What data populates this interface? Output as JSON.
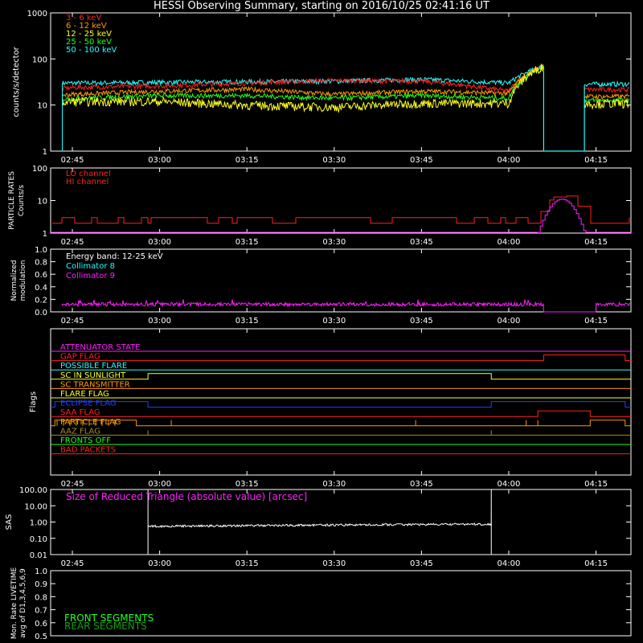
{
  "title": "HESSI Observing Summary, starting on 2016/10/25 02:41:16 UT",
  "time_ticks": [
    "02:45",
    "03:00",
    "03:15",
    "03:30",
    "03:45",
    "04:00",
    "04:15"
  ],
  "colors": {
    "red": "#ff2020",
    "orange": "#ff9a00",
    "yellow": "#ffff20",
    "green": "#20ff20",
    "cyan": "#20ffff",
    "magenta": "#ff20ff",
    "blue": "#2040ff",
    "olive": "#a08a30",
    "white": "#ffffff"
  },
  "chart_data": [
    {
      "type": "line",
      "ylabel": "counts/s/detector",
      "yscale": "log",
      "ylim": [
        1,
        1000
      ],
      "yticks": [
        "1",
        "10",
        "100",
        "1000"
      ],
      "series": [
        {
          "name": "3 - 6 keV",
          "color": "#ff2020"
        },
        {
          "name": "6 - 12 keV",
          "color": "#ff9a00"
        },
        {
          "name": "12 - 25 keV",
          "color": "#ffff20"
        },
        {
          "name": "25 - 50 keV",
          "color": "#20ff20"
        },
        {
          "name": "50 - 100 keV",
          "color": "#20ffff"
        }
      ],
      "x": [
        "02:42",
        "02:45",
        "03:00",
        "03:15",
        "03:30",
        "03:45",
        "04:00",
        "04:06"
      ],
      "values": [
        [
          22,
          24,
          26,
          30,
          34,
          33,
          20,
          70
        ],
        [
          16,
          17,
          20,
          22,
          17,
          20,
          18,
          70
        ],
        [
          11,
          12,
          12,
          10,
          9,
          11,
          11,
          70
        ],
        [
          13,
          14,
          16,
          16,
          14,
          16,
          14,
          70
        ],
        [
          30,
          30,
          31,
          32,
          33,
          36,
          30,
          70
        ]
      ],
      "gap": [
        "04:06",
        "04:13"
      ]
    },
    {
      "type": "line",
      "ylabel": "PARTICLE RATES Counts/s",
      "yscale": "log",
      "ylim": [
        1,
        100
      ],
      "yticks": [
        "1",
        "10",
        "100"
      ],
      "series": [
        {
          "name": "LO channel",
          "color": "#ff2020"
        },
        {
          "name": "HI channel",
          "color": "#ff20ff"
        }
      ],
      "lo_baseline": [
        2,
        3
      ],
      "peak_time": "04:09",
      "peak_values": [
        15,
        11
      ]
    },
    {
      "type": "line",
      "ylabel": "Normalized modulation",
      "ylim": [
        0,
        1
      ],
      "yticks": [
        "0.0",
        "0.2",
        "0.4",
        "0.6",
        "0.8",
        "1.0"
      ],
      "annotation": "Energy band: 12-25 keV",
      "series": [
        {
          "name": "Collimator 8",
          "color": "#20ffff"
        },
        {
          "name": "Collimator 9",
          "color": "#ff20ff",
          "mean": 0.12
        }
      ],
      "gap": [
        "04:06",
        "04:15"
      ]
    },
    {
      "type": "table",
      "ylabel": "Flags",
      "flags": [
        {
          "name": "ATTENUATOR STATE",
          "color": "#ff20ff",
          "on": []
        },
        {
          "name": "GAP FLAG",
          "color": "#ff2020",
          "on": [
            [
              "04:06",
              "04:20"
            ]
          ]
        },
        {
          "name": "POSSIBLE FLARE",
          "color": "#20ffff",
          "on": []
        },
        {
          "name": "SC IN SUNLIGHT",
          "color": "#ffff20",
          "on": [
            [
              "02:58",
              "03:57"
            ]
          ]
        },
        {
          "name": "SC TRANSMITTER",
          "color": "#ff9a00",
          "on": []
        },
        {
          "name": "FLARE FLAG",
          "color": "#ffff20",
          "on": []
        },
        {
          "name": "ECLIPSE FLAG",
          "color": "#2040ff",
          "on": [
            [
              "02:42",
              "02:58"
            ],
            [
              "03:57",
              "04:20"
            ]
          ]
        },
        {
          "name": "SAA FLAG",
          "color": "#ff2020",
          "on": [
            [
              "04:05",
              "04:14"
            ]
          ]
        },
        {
          "name": "PARTICLE FLAG",
          "color": "#ff9a00",
          "on": [
            [
              "02:42",
              "02:56"
            ],
            [
              "04:14",
              "04:20"
            ]
          ]
        },
        {
          "name": "AAZ FLAG",
          "color": "#a08a30",
          "on": []
        },
        {
          "name": "FRONTS OFF",
          "color": "#20ff20",
          "on": []
        },
        {
          "name": "BAD PACKETS",
          "color": "#ff2020",
          "on": []
        }
      ]
    },
    {
      "type": "line",
      "ylabel": "SAS",
      "yscale": "log",
      "ylim": [
        0.01,
        100
      ],
      "yticks": [
        "0.01",
        "0.10",
        "1.00",
        "10.00",
        "100.00"
      ],
      "annotation": "Size of Reduced Triangle (absolute value) [arcsec]",
      "series": [
        {
          "name": "SAS",
          "color": "#ffffff",
          "start": "02:58",
          "end": "03:57",
          "start_value": 0.55,
          "end_value": 0.75
        }
      ]
    },
    {
      "type": "line",
      "ylabel": "Mon. Rate LIVETIME avg of D1,3,4,5,6,9",
      "ylim": [
        0.5,
        1
      ],
      "yticks": [
        "0.5",
        "0.6",
        "0.7",
        "0.8",
        "0.9",
        "1.0"
      ],
      "series": [
        {
          "name": "FRONT SEGMENTS",
          "color": "#20ff20"
        },
        {
          "name": "REAR SEGMENTS",
          "color": "#10a010"
        }
      ]
    }
  ]
}
